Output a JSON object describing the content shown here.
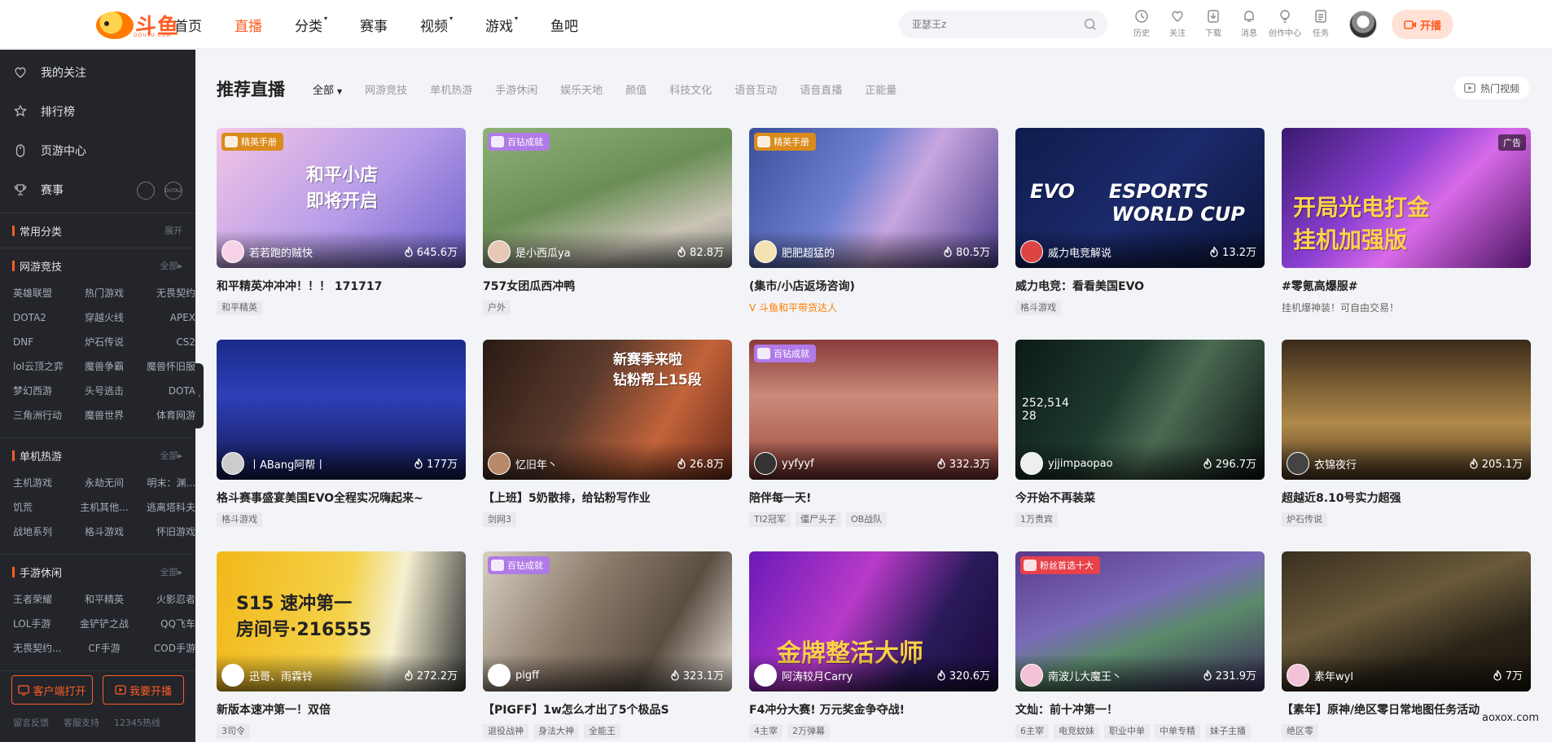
{
  "header": {
    "logo_text": "斗鱼",
    "logo_sub": "DOUYU.COM",
    "nav": [
      {
        "label": "首页",
        "caret": false
      },
      {
        "label": "直播",
        "caret": false,
        "active": true
      },
      {
        "label": "分类",
        "caret": true
      },
      {
        "label": "赛事",
        "caret": false
      },
      {
        "label": "视频",
        "caret": true
      },
      {
        "label": "游戏",
        "caret": true
      },
      {
        "label": "鱼吧",
        "caret": false
      }
    ],
    "search_placeholder": "亚瑟王z",
    "tools": [
      {
        "label": "历史",
        "icon": "clock-icon"
      },
      {
        "label": "关注",
        "icon": "heart-icon"
      },
      {
        "label": "下载",
        "icon": "download-icon"
      },
      {
        "label": "消息",
        "icon": "bell-icon"
      },
      {
        "label": "创作中心",
        "icon": "bulb-icon"
      },
      {
        "label": "任务",
        "icon": "task-icon"
      }
    ],
    "kaibo_label": "开播",
    "accent": "#ff5d23"
  },
  "sidebar": {
    "main_links": [
      {
        "label": "我的关注",
        "icon": "heart-icon"
      },
      {
        "label": "排行榜",
        "icon": "rank-icon"
      },
      {
        "label": "页游中心",
        "icon": "mouse-icon"
      },
      {
        "label": "赛事",
        "icon": "trophy-icon",
        "extras": [
          "",
          "DOTA2"
        ]
      }
    ],
    "common": {
      "title": "常用分类",
      "more": "展开"
    },
    "sections": [
      {
        "title": "网游竞技",
        "more": "全部",
        "items": [
          "英雄联盟",
          "热门游戏",
          "无畏契约",
          "DOTA2",
          "穿越火线",
          "APEX",
          "DNF",
          "炉石传说",
          "CS2",
          "lol云顶之弈",
          "魔兽争霸",
          "魔兽怀旧服",
          "梦幻西游",
          "头号逃击",
          "DOTA",
          "三角洲行动",
          "魔兽世界",
          "体育网游"
        ]
      },
      {
        "title": "单机热游",
        "more": "全部",
        "items": [
          "主机游戏",
          "永劫无间",
          "明末：渊...",
          "饥荒",
          "主机其他...",
          "逃离塔科夫",
          "战地系列",
          "格斗游戏",
          "怀旧游戏"
        ]
      },
      {
        "title": "手游休闲",
        "more": "全部",
        "items": [
          "王者荣耀",
          "和平精英",
          "火影忍者",
          "LOL手游",
          "金铲铲之战",
          "QQ飞车",
          "无畏契约...",
          "CF手游",
          "COD手游"
        ]
      }
    ],
    "buttons": [
      "客户端打开",
      "我要开播"
    ],
    "footer_links": [
      "留言反馈",
      "客服支持",
      "12345热线"
    ]
  },
  "main": {
    "title": "推荐直播",
    "filters": [
      "全部",
      "网游竞技",
      "单机热游",
      "手游休闲",
      "娱乐天地",
      "颜值",
      "科技文化",
      "语音互动",
      "语音直播",
      "正能量"
    ],
    "hot_video": "热门视频",
    "cards": [
      {
        "badge": "精英手册",
        "badge_color": "#d98b1c",
        "anchor": "若若跑的贼快",
        "hot": "645.6万",
        "title": "和平精英冲冲冲！！！ 171717",
        "tags": [
          "和平精英"
        ],
        "desc": "",
        "bg": "linear-gradient(135deg,#f4c6e6,#b59be8 55%,#6c5fc7)",
        "text": "和平小店\n即将开启",
        "text_color": "#fff",
        "avatar_bg": "#f7d2e6"
      },
      {
        "badge": "百钻成就",
        "badge_color": "#b07ae8",
        "anchor": "是小西瓜ya",
        "hot": "82.8万",
        "title": "757女团瓜西冲鸭",
        "tags": [
          "户外"
        ],
        "desc": "",
        "bg": "linear-gradient(160deg,#8fb27a,#6a8e55 45%,#c9c3b4 75%,#8a8d86)",
        "text": "",
        "text_color": "#fff",
        "avatar_bg": "#e7c8b6"
      },
      {
        "badge": "精英手册",
        "badge_color": "#d98b1c",
        "anchor": "肥肥超猛的",
        "hot": "80.5万",
        "title": "(集市/小店返场咨询)",
        "tags": [],
        "desc": "斗鱼和平带货达人",
        "desc_orange": true,
        "bg": "linear-gradient(120deg,#3a4f9a,#6e7fd0 40%,#c8a6e0 60%,#4a3c8a)",
        "text": "",
        "text_color": "#fff",
        "avatar_bg": "#f2e3b0"
      },
      {
        "badge": "",
        "badge_color": "",
        "anchor": "威力电竞解说",
        "hot": "13.2万",
        "title": "威力电竞：看看美国EVO",
        "tags": [
          "格斗游戏"
        ],
        "desc": "",
        "bg": "linear-gradient(135deg,#0e1c4d,#1b2a6b 50%,#0b1438)",
        "text": "EVO     ESPORTS\n            WORLD CUP",
        "text_color": "#fff",
        "avatar_bg": "#d44"
      },
      {
        "badge": "",
        "badge_color": "",
        "ad": "广告",
        "anchor": "",
        "hot": "",
        "title": "#零氪高爆服#",
        "tags": [],
        "desc": "挂机爆神装！可自由交易！",
        "bg": "linear-gradient(135deg,#3a1a6e,#8a3fd1 40%,#d86ae8 60%,#4a1360)",
        "text": "开局光电打金\n挂机加强版",
        "text_color": "#ffd24a",
        "avatar_bg": ""
      },
      {
        "badge": "",
        "badge_color": "",
        "anchor": "丨ABang阿帮丨",
        "hot": "177万",
        "title": "格斗赛事盛宴美国EVO全程实况嗨起来~",
        "tags": [
          "格斗游戏"
        ],
        "desc": "",
        "bg": "linear-gradient(180deg,#1a2a8a,#2e3fb8 40%,#121a4e)",
        "text": "",
        "text_color": "#fff",
        "avatar_bg": "#ccc"
      },
      {
        "badge": "",
        "badge_color": "",
        "anchor": "忆旧年丶",
        "hot": "26.8万",
        "title": "【上班】5奶散排，给钻粉写作业",
        "tags": [
          "剑网3"
        ],
        "desc": "",
        "bg": "linear-gradient(120deg,#2a1a14,#5a3a2c 40%,#c2633a 70%,#6a2a1a)",
        "text": "新赛季来啦\n钻粉帮上15段",
        "text_color": "#fff",
        "avatar_bg": "#b98a6a"
      },
      {
        "badge": "百钻成就",
        "badge_color": "#b07ae8",
        "anchor": "yyfyyf",
        "hot": "332.3万",
        "title": "陪伴每一天!",
        "tags": [
          "TI2冠军",
          "僵尸头子",
          "OB战队"
        ],
        "desc": "",
        "bg": "linear-gradient(180deg,#8a3a3a,#c98a7a 40%,#b56a5a 70%,#6a2a2a)",
        "text": "",
        "text_color": "#fff",
        "avatar_bg": "#333"
      },
      {
        "badge": "",
        "badge_color": "",
        "anchor": "yjjimpaopao",
        "hot": "296.7万",
        "title": "今开始不再装菜",
        "tags": [
          "1万贵宾"
        ],
        "desc": "",
        "bg": "linear-gradient(120deg,#0c1a16,#1e3a2e 40%,#4a6a52 60%,#0a1210)",
        "text": "252,514\n28",
        "text_color": "#fff",
        "avatar_bg": "#eee"
      },
      {
        "badge": "",
        "badge_color": "",
        "anchor": "衣锦夜行",
        "hot": "205.1万",
        "title": "超越近8.10号实力超强",
        "tags": [
          "炉石传说"
        ],
        "desc": "",
        "bg": "linear-gradient(180deg,#3a2a1a,#8a6a3a 40%,#b08a4a 60%,#4a3420)",
        "text": "",
        "text_color": "#fff",
        "avatar_bg": "#444"
      },
      {
        "badge": "",
        "badge_color": "",
        "anchor": "迅哥、雨霖铃",
        "hot": "272.2万",
        "title": "新版本速冲第一！双倍",
        "tags": [
          "3司令"
        ],
        "desc": "",
        "bg": "linear-gradient(100deg,#f2b81a,#f4d24a 50%,#f5f0d0 70%,#3a3a3a)",
        "text": "S15 速冲第一\n房间号·216555",
        "text_color": "#222",
        "avatar_bg": "#fff"
      },
      {
        "badge": "百钻成就",
        "badge_color": "#b07ae8",
        "anchor": "pigff",
        "hot": "323.1万",
        "title": "【PIGFF】1w怎么才出了5个极品S",
        "tags": [
          "退役战神",
          "身法大神",
          "全能王"
        ],
        "desc": "",
        "bg": "linear-gradient(120deg,#d8cfc0,#8a7a6a 40%,#5a4e42 70%,#e8e0d8)",
        "text": "",
        "text_color": "#fff",
        "avatar_bg": "#fff"
      },
      {
        "badge": "",
        "badge_color": "",
        "anchor": "阿涛较月Carry",
        "hot": "320.6万",
        "title": "F4冲分大赛! 万元奖金争夺战!",
        "tags": [
          "4主宰",
          "2万弹幕"
        ],
        "desc": "",
        "bg": "linear-gradient(120deg,#6a1ab8,#b83ac8 40%,#2a1a5a 70%,#1a0a3a)",
        "text": "金牌整活大师",
        "text_color": "#ffd24a",
        "avatar_bg": "#fff"
      },
      {
        "badge": "粉丝首选十大",
        "badge_color": "#e8414a",
        "anchor": "南波儿大魔王丶",
        "hot": "231.9万",
        "title": "文灿：前十冲第一！",
        "tags": [
          "6主宰",
          "电竞蚊妹",
          "职业中单",
          "中单专精",
          "妹子主播"
        ],
        "desc": "",
        "bg": "linear-gradient(160deg,#5a3a8a,#7a6ab8 40%,#5a8a6a 60%,#3a2a5a)",
        "text": "",
        "text_color": "#fff",
        "avatar_bg": "#f4c2d8"
      },
      {
        "badge": "",
        "badge_color": "",
        "anchor": "素年wyl",
        "hot": "7万",
        "title": "【素年】原神/绝区零日常地图任务活动",
        "tags": [
          "绝区零"
        ],
        "desc": "",
        "bg": "linear-gradient(160deg,#3a3020,#6a5a3a 40%,#2a2418 70%,#1a140c)",
        "text": "",
        "text_color": "#fff",
        "avatar_bg": "#f4c2d8"
      }
    ]
  },
  "watermark": "aoxox.com"
}
